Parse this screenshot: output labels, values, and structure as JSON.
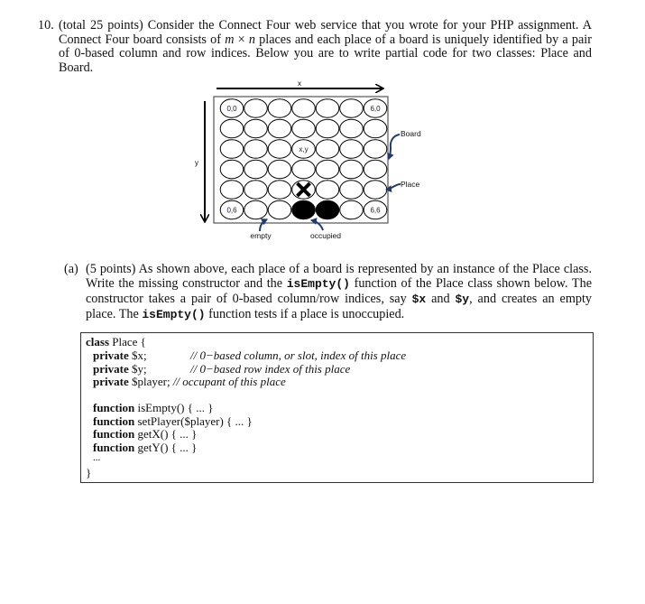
{
  "problem": {
    "number": "10.",
    "text_parts": [
      "(total 25 points) Consider the Connect Four web service that you wrote for your PHP assignment. A Connect Four board consists of ",
      "m",
      " × ",
      "n",
      " places and each place of a board is uniquely identified by a pair of 0-based column and row indices. Below you are to write partial code for two classes: Place and Board."
    ]
  },
  "diagram": {
    "x_axis_label": "x",
    "y_axis_label": "y",
    "columns": 7,
    "rows": 6,
    "cell_labels": [
      {
        "col": 0,
        "row": 0,
        "text": "0,0"
      },
      {
        "col": 6,
        "row": 0,
        "text": "6,0"
      },
      {
        "col": 3,
        "row": 2,
        "text": "x,y"
      },
      {
        "col": 0,
        "row": 5,
        "text": "0,6"
      },
      {
        "col": 6,
        "row": 5,
        "text": "6,6"
      }
    ],
    "marked_cells": [
      {
        "col": 3,
        "row": 4,
        "mark": "X"
      }
    ],
    "filled_cells": [
      {
        "col": 3,
        "row": 5
      },
      {
        "col": 4,
        "row": 5
      }
    ],
    "callouts": {
      "board": "Board",
      "place": "Place",
      "empty": "empty",
      "occupied": "occupied"
    },
    "callout_color": "#1f3a6e"
  },
  "part_a": {
    "label": "(a)",
    "segments": [
      {
        "t": "(5 points) As shown above, each place of a board is represented by an instance of the Place class. Write the missing constructor and the ",
        "mono": false
      },
      {
        "t": "isEmpty()",
        "mono": true
      },
      {
        "t": " function of the Place class shown below. The constructor takes a pair of 0-based column/row indices, say ",
        "mono": false
      },
      {
        "t": "$x",
        "mono": true
      },
      {
        "t": " and ",
        "mono": false
      },
      {
        "t": "$y",
        "mono": true
      },
      {
        "t": ", and creates an empty place. The ",
        "mono": false
      },
      {
        "t": "isEmpty()",
        "mono": true
      },
      {
        "t": " function tests if a place is unoccupied.",
        "mono": false
      }
    ]
  },
  "code": {
    "class_kw": "class",
    "class_rest": " Place {",
    "fields": [
      {
        "kw": "private",
        "name": " $x;",
        "comment": "// 0−based column, or slot, index of this place"
      },
      {
        "kw": "private",
        "name": " $y;",
        "comment": "// 0−based row index of this place"
      },
      {
        "kw": "private",
        "name": " $player;",
        "comment": " // occupant of this place"
      }
    ],
    "functions": [
      {
        "kw": "function",
        "sig": " isEmpty() { ... }"
      },
      {
        "kw": "function",
        "sig": " setPlayer($player) { ... }"
      },
      {
        "kw": "function",
        "sig": " getX() { ... }"
      },
      {
        "kw": "function",
        "sig": " getY() { ... }"
      }
    ],
    "ellipsis": "...",
    "closing": "}"
  }
}
